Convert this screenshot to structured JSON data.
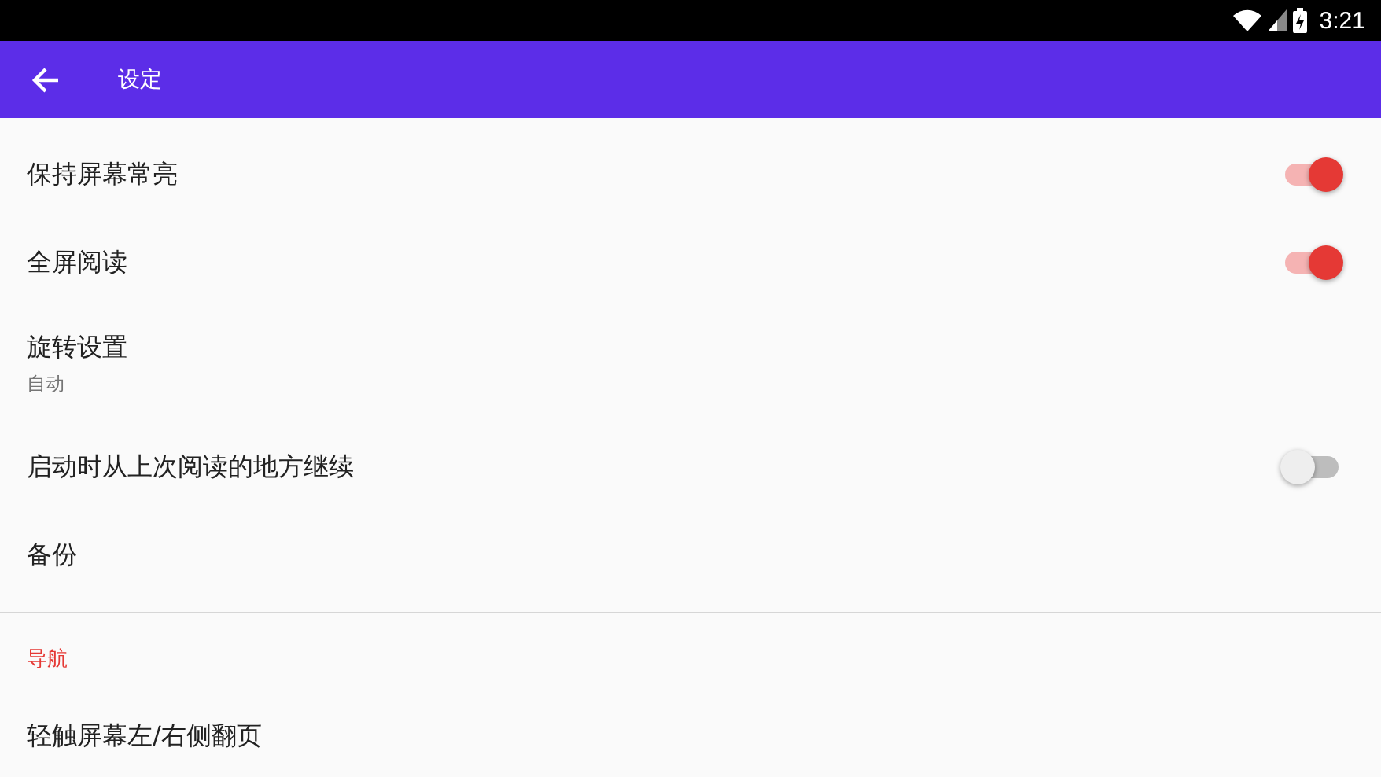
{
  "status_bar": {
    "time": "3:21"
  },
  "app_bar": {
    "title": "设定"
  },
  "sections": [
    {
      "items": [
        {
          "kind": "toggle",
          "title": "保持屏幕常亮",
          "on": true
        },
        {
          "kind": "toggle",
          "title": "全屏阅读",
          "on": true
        },
        {
          "kind": "plain",
          "title": "旋转设置",
          "summary": "自动"
        },
        {
          "kind": "toggle",
          "title": "启动时从上次阅读的地方继续",
          "on": false
        },
        {
          "kind": "plain",
          "title": "备份"
        }
      ]
    },
    {
      "header": "导航",
      "items": [
        {
          "kind": "plain",
          "title": "轻触屏幕左/右侧翻页"
        }
      ]
    }
  ]
}
